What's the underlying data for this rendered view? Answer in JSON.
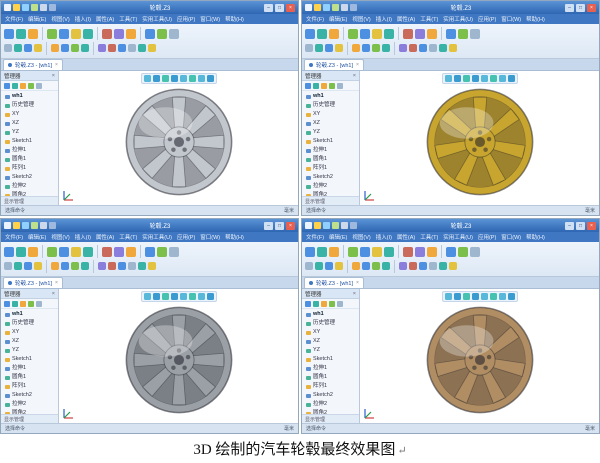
{
  "caption": "3D 绘制的汽车轮毂最终效果图",
  "caption_mark": "↵",
  "app": {
    "menu_items": [
      "文件(F)",
      "编辑(E)",
      "视图(V)",
      "插入(I)",
      "属性(A)",
      "工具(T)",
      "实用工具(U)",
      "应用(P)",
      "窗口(W)",
      "帮助(H)"
    ],
    "window_controls": {
      "minimize": "–",
      "maximize": "□",
      "close": "×"
    },
    "doc_tab": "轮毂.Z3 - [wh1]",
    "tab_close_glyph": "×",
    "panel_title": "管理器",
    "panel_close_glyph": "×",
    "panel_footer": "显示管理",
    "tree_items": [
      "wh1",
      "历史管理",
      "XY",
      "XZ",
      "YZ",
      "Sketch1",
      "拉伸1",
      "圆角1",
      "阵列1",
      "Sketch2",
      "拉伸2",
      "圆角2"
    ],
    "status_left": "选择命令",
    "status_right": "毫米"
  },
  "windows": [
    {
      "title": "轮毂.Z3",
      "wheel_color": "#c2c6cd",
      "spokes": 8
    },
    {
      "title": "轮毂.Z3",
      "wheel_color": "#c7a52f",
      "spokes": 7
    },
    {
      "title": "轮毂.Z3",
      "wheel_color": "#9aa0a6",
      "spokes": 8
    },
    {
      "title": "轮毂.Z3",
      "wheel_color": "#b08d62",
      "spokes": 7
    }
  ]
}
